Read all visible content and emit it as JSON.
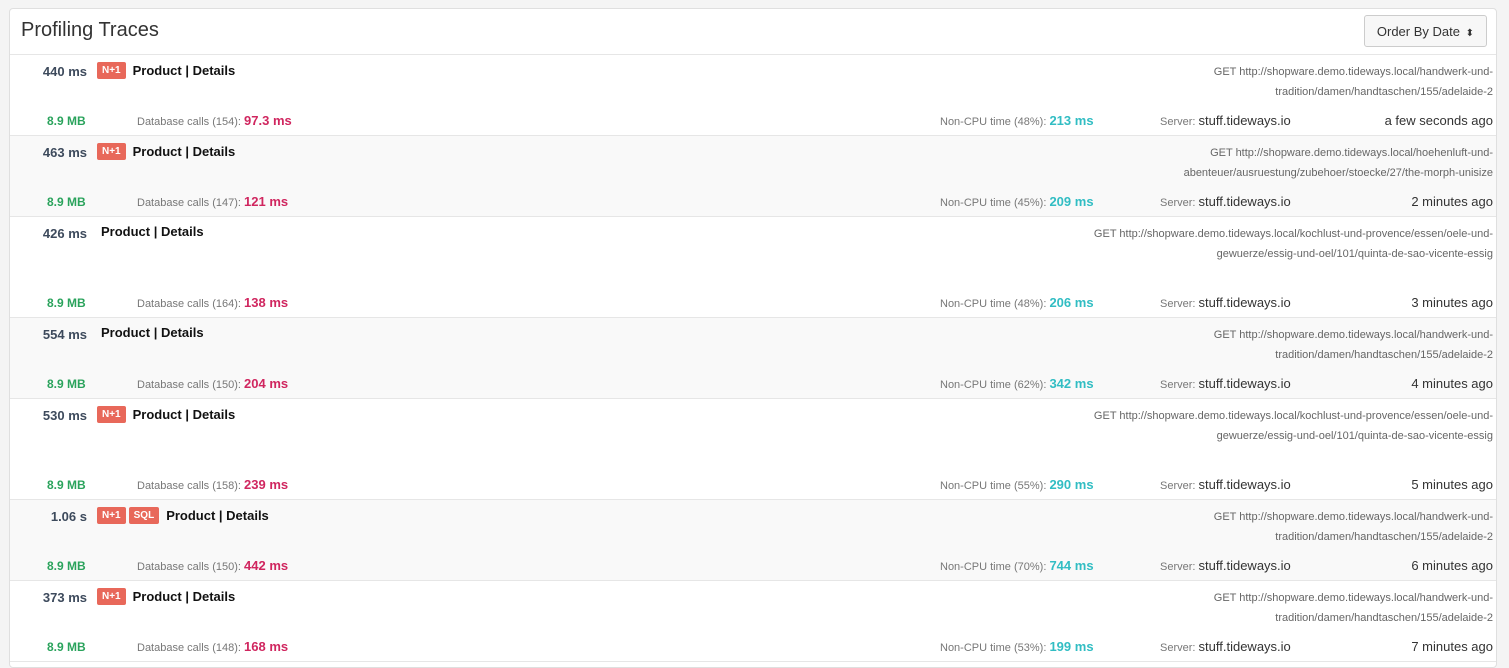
{
  "header": {
    "title": "Profiling Traces",
    "order_button": "Order By Date",
    "sort_icon": "⬍"
  },
  "labels": {
    "db_prefix": "Database calls",
    "noncpu_prefix": "Non-CPU time",
    "server_prefix": "Server:"
  },
  "traces": [
    {
      "duration": "440 ms",
      "badges": [
        "N+1"
      ],
      "name": "Product | Details",
      "url": "GET http://shopware.demo.tideways.local/handwerk-und-tradition/damen/handtaschen/155/adelaide-2",
      "memory": "8.9 MB",
      "db_count": "154",
      "db_time": "97.3 ms",
      "noncpu_pct": "48%",
      "noncpu_time": "213 ms",
      "server": "stuff.tideways.io",
      "ago": "a few seconds ago"
    },
    {
      "duration": "463 ms",
      "badges": [
        "N+1"
      ],
      "name": "Product | Details",
      "url": "GET http://shopware.demo.tideways.local/hoehenluft-und-abenteuer/ausruestung/zubehoer/stoecke/27/the-morph-unisize",
      "memory": "8.9 MB",
      "db_count": "147",
      "db_time": "121 ms",
      "noncpu_pct": "45%",
      "noncpu_time": "209 ms",
      "server": "stuff.tideways.io",
      "ago": "2 minutes ago"
    },
    {
      "duration": "426 ms",
      "badges": [],
      "name": "Product | Details",
      "url": "GET http://shopware.demo.tideways.local/kochlust-und-provence/essen/oele-und-gewuerze/essig-und-oel/101/quinta-de-sao-vicente-essig",
      "memory": "8.9 MB",
      "db_count": "164",
      "db_time": "138 ms",
      "noncpu_pct": "48%",
      "noncpu_time": "206 ms",
      "server": "stuff.tideways.io",
      "ago": "3 minutes ago"
    },
    {
      "duration": "554 ms",
      "badges": [],
      "name": "Product | Details",
      "url": "GET http://shopware.demo.tideways.local/handwerk-und-tradition/damen/handtaschen/155/adelaide-2",
      "memory": "8.9 MB",
      "db_count": "150",
      "db_time": "204 ms",
      "noncpu_pct": "62%",
      "noncpu_time": "342 ms",
      "server": "stuff.tideways.io",
      "ago": "4 minutes ago"
    },
    {
      "duration": "530 ms",
      "badges": [
        "N+1"
      ],
      "name": "Product | Details",
      "url": "GET http://shopware.demo.tideways.local/kochlust-und-provence/essen/oele-und-gewuerze/essig-und-oel/101/quinta-de-sao-vicente-essig",
      "memory": "8.9 MB",
      "db_count": "158",
      "db_time": "239 ms",
      "noncpu_pct": "55%",
      "noncpu_time": "290 ms",
      "server": "stuff.tideways.io",
      "ago": "5 minutes ago"
    },
    {
      "duration": "1.06 s",
      "badges": [
        "N+1",
        "SQL"
      ],
      "name": "Product | Details",
      "url": "GET http://shopware.demo.tideways.local/handwerk-und-tradition/damen/handtaschen/155/adelaide-2",
      "memory": "8.9 MB",
      "db_count": "150",
      "db_time": "442 ms",
      "noncpu_pct": "70%",
      "noncpu_time": "744 ms",
      "server": "stuff.tideways.io",
      "ago": "6 minutes ago"
    },
    {
      "duration": "373 ms",
      "badges": [
        "N+1"
      ],
      "name": "Product | Details",
      "url": "GET http://shopware.demo.tideways.local/handwerk-und-tradition/damen/handtaschen/155/adelaide-2",
      "memory": "8.9 MB",
      "db_count": "148",
      "db_time": "168 ms",
      "noncpu_pct": "53%",
      "noncpu_time": "199 ms",
      "server": "stuff.tideways.io",
      "ago": "7 minutes ago"
    }
  ]
}
